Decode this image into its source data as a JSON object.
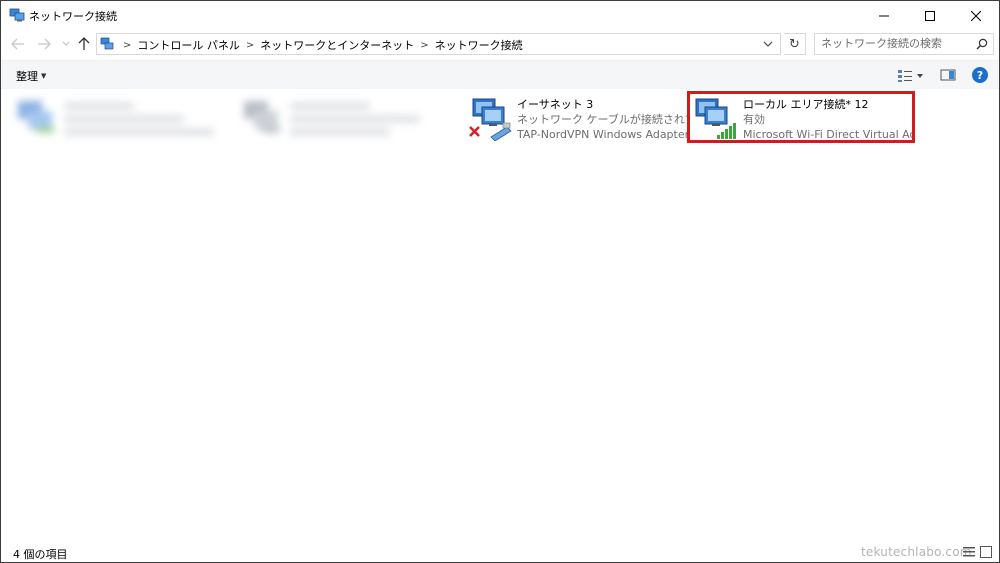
{
  "window": {
    "title": "ネットワーク接続"
  },
  "icons": {
    "app": "network-connections-icon",
    "back": "back-arrow-icon",
    "forward": "forward-arrow-icon",
    "up": "up-arrow-icon",
    "refresh": "refresh-icon",
    "search": "search-icon",
    "help": "help-icon"
  },
  "address": {
    "breadcrumbs": [
      "コントロール パネル",
      "ネットワークとインターネット",
      "ネットワーク接続"
    ],
    "refresh_glyph": "↻"
  },
  "search": {
    "placeholder": "ネットワーク接続の検索"
  },
  "toolbar": {
    "organize_label": "整理",
    "help_glyph": "?"
  },
  "connections": [
    {
      "name": "イーサネット 3",
      "status": "ネットワーク ケーブルが接続されていま...",
      "device": "TAP-NordVPN Windows Adapter ...",
      "state": "disconnected"
    },
    {
      "name": "ローカル エリア接続* 12",
      "status": "有効",
      "device": "Microsoft Wi-Fi Direct Virtual Ada...",
      "state": "enabled",
      "highlighted": true
    }
  ],
  "statusbar": {
    "item_count": "4 個の項目",
    "watermark": "tekutechlabo.com"
  },
  "colors": {
    "highlight_border": "#d7191f",
    "help_blue": "#1a6fce",
    "command_bar": "#f5f6f7"
  }
}
